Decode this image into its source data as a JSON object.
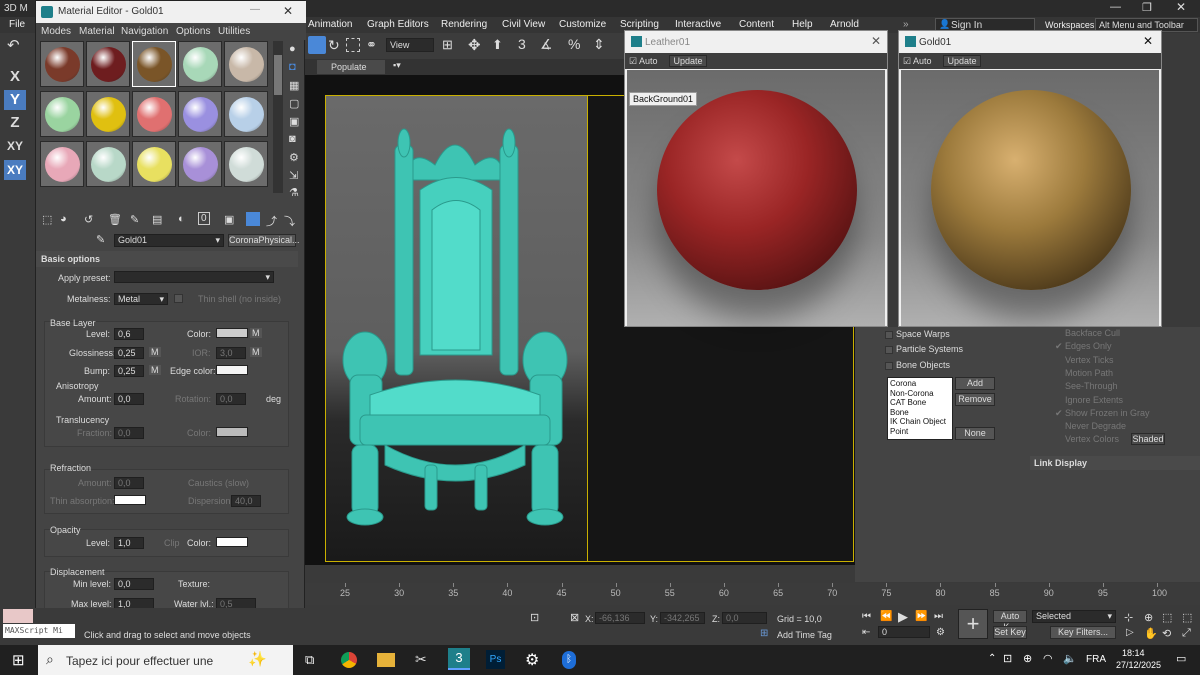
{
  "app": {
    "title_fragment": "3D M",
    "workspaces_label": "Workspaces:",
    "workspace_value": "Alt Menu and Toolbar",
    "sign_in": "Sign In"
  },
  "menu": [
    "File",
    "Animation",
    "Graph Editors",
    "Rendering",
    "Civil View",
    "Customize",
    "Scripting",
    "Interactive",
    "Content",
    "Help",
    "Arnold"
  ],
  "toolbar": {
    "view_dropdown": "View",
    "populate_tab": "Populate"
  },
  "axes": [
    "X",
    "Y",
    "Z",
    "XY",
    "XY"
  ],
  "material_editor": {
    "title": "Material Editor - Gold01",
    "menu": [
      "Modes",
      "Material",
      "Navigation",
      "Options",
      "Utilities"
    ],
    "material_name": "Gold01",
    "material_type": "CoronaPhysical...",
    "rollout_title": "Basic options",
    "apply_preset_label": "Apply preset:",
    "metalness_label": "Metalness:",
    "metalness_value": "Metal",
    "thin_shell_label": "Thin shell (no inside)",
    "base_layer_title": "Base Layer",
    "level_label": "Level:",
    "level_value": "0,6",
    "color_label": "Color:",
    "glossiness_label": "Glossiness:",
    "glossiness_value": "0,25",
    "ior_label": "IOR:",
    "ior_value": "3,0",
    "bump_label": "Bump:",
    "bump_value": "0,25",
    "edge_color_label": "Edge color:",
    "anisotropy_title": "Anisotropy",
    "amount_label": "Amount:",
    "amount_value": "0,0",
    "rotation_label": "Rotation:",
    "rotation_value": "0,0",
    "deg": "deg",
    "translucency_title": "Translucency",
    "fraction_label": "Fraction:",
    "fraction_value": "0,0",
    "refraction_title": "Refraction",
    "refr_amount_label": "Amount:",
    "refr_amount_value": "0,0",
    "caustics_label": "Caustics (slow)",
    "thin_absorption_label": "Thin absorption:",
    "dispersion_label": "Dispersion:",
    "dispersion_value": "40,0",
    "opacity_title": "Opacity",
    "op_level_label": "Level:",
    "op_level_value": "1,0",
    "clip_label": "Clip",
    "op_color_label": "Color:",
    "displacement_title": "Displacement",
    "min_level_label": "Min level:",
    "min_level_value": "0,0",
    "texture_label": "Texture:",
    "max_level_label": "Max level:",
    "max_level_value": "1,0",
    "water_lvl_label": "Water lvl.:",
    "water_lvl_value": "0,5"
  },
  "swatch_colors": [
    "#7a3a2a",
    "#6e1d1f",
    "#7a5528",
    "#a8d8b8",
    "#c8b8a8",
    "#9ad4a0",
    "#e0c010",
    "#e07070",
    "#9a90e0",
    "#b8d0e8",
    "#e8a8b8",
    "#b8d8c8",
    "#e8e060",
    "#a890d8",
    "#d0dcd8"
  ],
  "preview_leather": {
    "title": "Leather01",
    "auto": "Auto",
    "update": "Update",
    "badge": "BackGround01"
  },
  "preview_gold": {
    "title": "Gold01",
    "auto": "Auto",
    "update": "Update"
  },
  "command_panel": {
    "space_warps": "Space Warps",
    "particle_systems": "Particle Systems",
    "bone_objects": "Bone Objects",
    "list": [
      "Corona",
      "Non-Corona",
      "CAT Bone",
      "Bone",
      "IK Chain Object",
      "Point"
    ],
    "add": "Add",
    "remove": "Remove",
    "none": "None",
    "display_props": [
      "Backface Cull",
      "Edges Only",
      "Vertex Ticks",
      "Motion Path",
      "See-Through",
      "Ignore Extents",
      "Show Frozen in Gray",
      "Never Degrade",
      "Vertex Colors"
    ],
    "shaded": "Shaded",
    "link_display": "Link Display"
  },
  "timeline_ticks": [
    "25",
    "30",
    "35",
    "40",
    "45",
    "50",
    "55",
    "60",
    "65",
    "70",
    "75",
    "80",
    "85",
    "90",
    "95",
    "100"
  ],
  "status": {
    "maxscript": "MAXScript Mi",
    "prompt": "Click and drag to select and move objects",
    "x_label": "X:",
    "x_value": "-66,136",
    "y_label": "Y:",
    "y_value": "-342,265",
    "z_label": "Z:",
    "z_value": "0,0",
    "grid": "Grid = 10,0",
    "add_time_tag": "Add Time Tag",
    "auto_key": "Auto K...",
    "set_key": "Set Key",
    "selected": "Selected",
    "key_filters": "Key Filters...",
    "frame": "0"
  },
  "taskbar": {
    "search": "Tapez ici pour effectuer une",
    "lang": "FRA",
    "time": "18:14",
    "date": "27/12/2025"
  }
}
